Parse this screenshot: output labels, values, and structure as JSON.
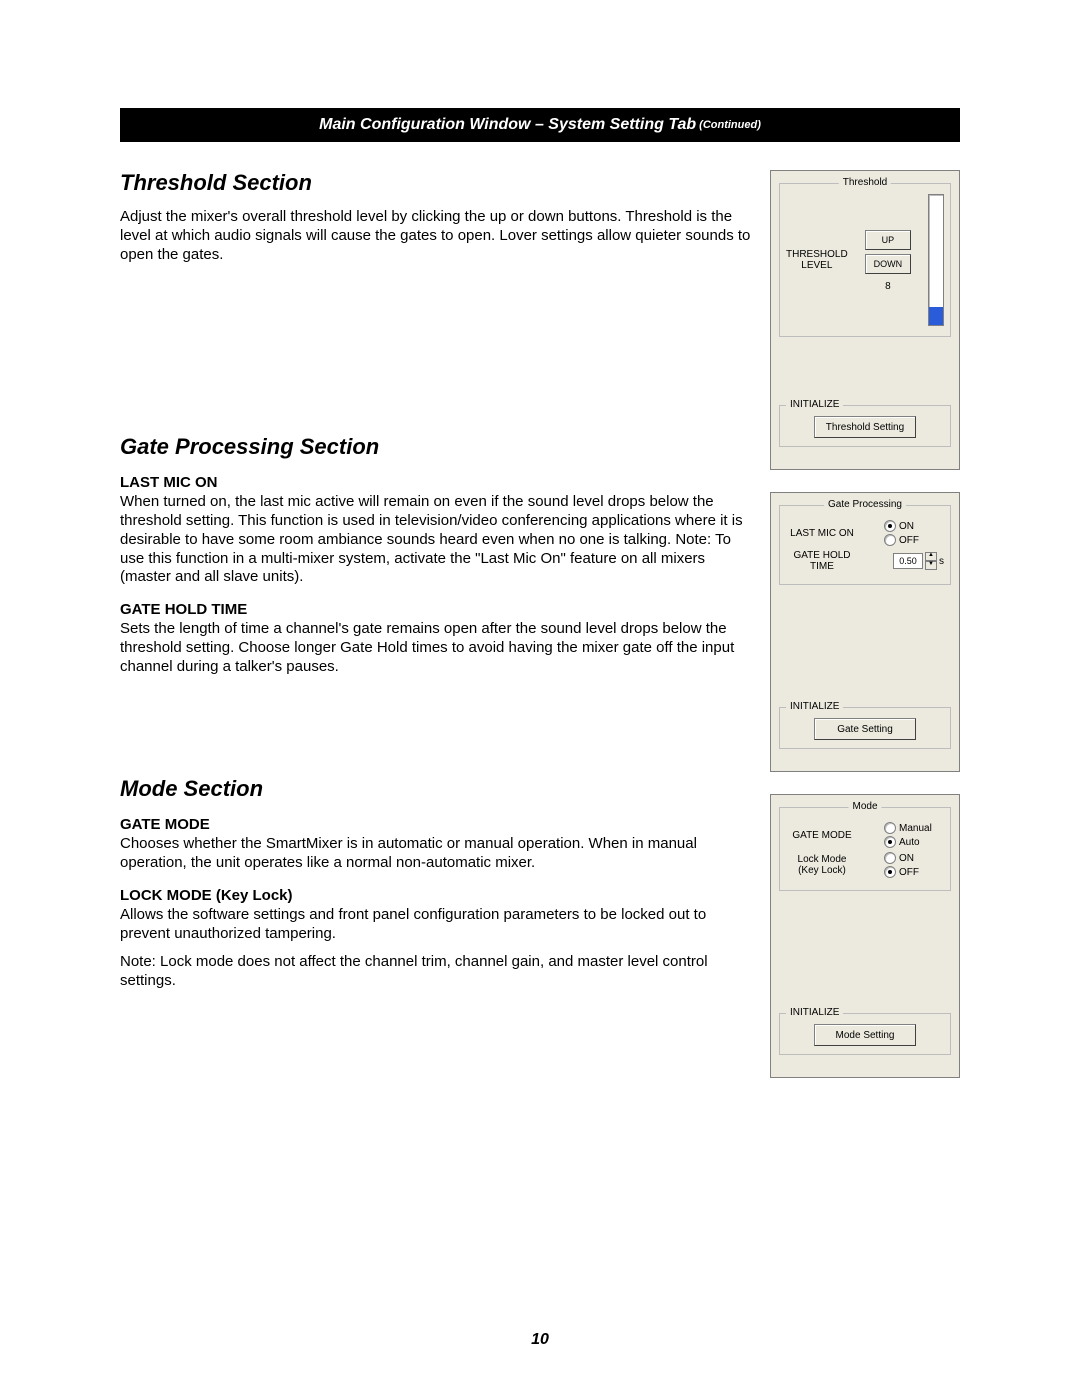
{
  "title_bar": {
    "text": "Main Configuration Window – System Setting Tab",
    "suffix": "(Continued)"
  },
  "page_number": "10",
  "threshold_section": {
    "heading": "Threshold Section",
    "para": "Adjust the mixer's overall threshold level by clicking the up or down buttons. Threshold is the level at which audio signals will cause the gates to open. Lover settings allow quieter sounds to open the gates."
  },
  "gate_processing_section": {
    "heading": "Gate Processing Section",
    "last_mic_on_head": "LAST MIC ON",
    "last_mic_on_para": "When turned on, the last mic active will remain on even if the sound level drops below the threshold setting. This function is used in television/video conferencing applications where it is desirable to have some room ambiance sounds heard even when no one is talking.  Note: To use this function in a multi-mixer system, activate the \"Last Mic On\" feature on all mixers (master and all slave units).",
    "gate_hold_head": "GATE HOLD TIME",
    "gate_hold_para": "Sets the length of time a channel's gate remains open after the sound level drops below the threshold setting. Choose longer Gate Hold times to avoid having the mixer gate off the input channel during a talker's pauses."
  },
  "mode_section": {
    "heading": "Mode Section",
    "gate_mode_head": "GATE MODE",
    "gate_mode_para": "Chooses whether the SmartMixer is in automatic or manual operation. When in manual operation, the unit operates like a normal non-automatic mixer.",
    "lock_mode_head": "LOCK MODE (Key Lock)",
    "lock_mode_para": "Allows the software settings and front panel configuration parameters to be locked out to prevent unauthorized tampering.",
    "lock_mode_note": "Note: Lock mode does not affect the channel trim, channel gain, and master level control settings."
  },
  "threshold_panel": {
    "legend": "Threshold",
    "label_line1": "THRESHOLD",
    "label_line2": "LEVEL",
    "up_label": "UP",
    "down_label": "DOWN",
    "value": "8",
    "init_legend": "INITIALIZE",
    "init_button": "Threshold Setting"
  },
  "gate_panel": {
    "legend": "Gate Processing",
    "last_mic_label": "LAST MIC ON",
    "on_label": "ON",
    "off_label": "OFF",
    "last_mic_value": "ON",
    "gate_hold_label_l1": "GATE HOLD",
    "gate_hold_label_l2": "TIME",
    "gate_hold_value": "0.50",
    "gate_hold_unit": "s",
    "init_legend": "INITIALIZE",
    "init_button": "Gate Setting"
  },
  "mode_panel": {
    "legend": "Mode",
    "gate_mode_label": "GATE MODE",
    "manual_label": "Manual",
    "auto_label": "Auto",
    "gate_mode_value": "Auto",
    "lock_label_l1": "Lock Mode",
    "lock_label_l2": "(Key Lock)",
    "on_label": "ON",
    "off_label": "OFF",
    "lock_value": "OFF",
    "init_legend": "INITIALIZE",
    "init_button": "Mode Setting"
  }
}
